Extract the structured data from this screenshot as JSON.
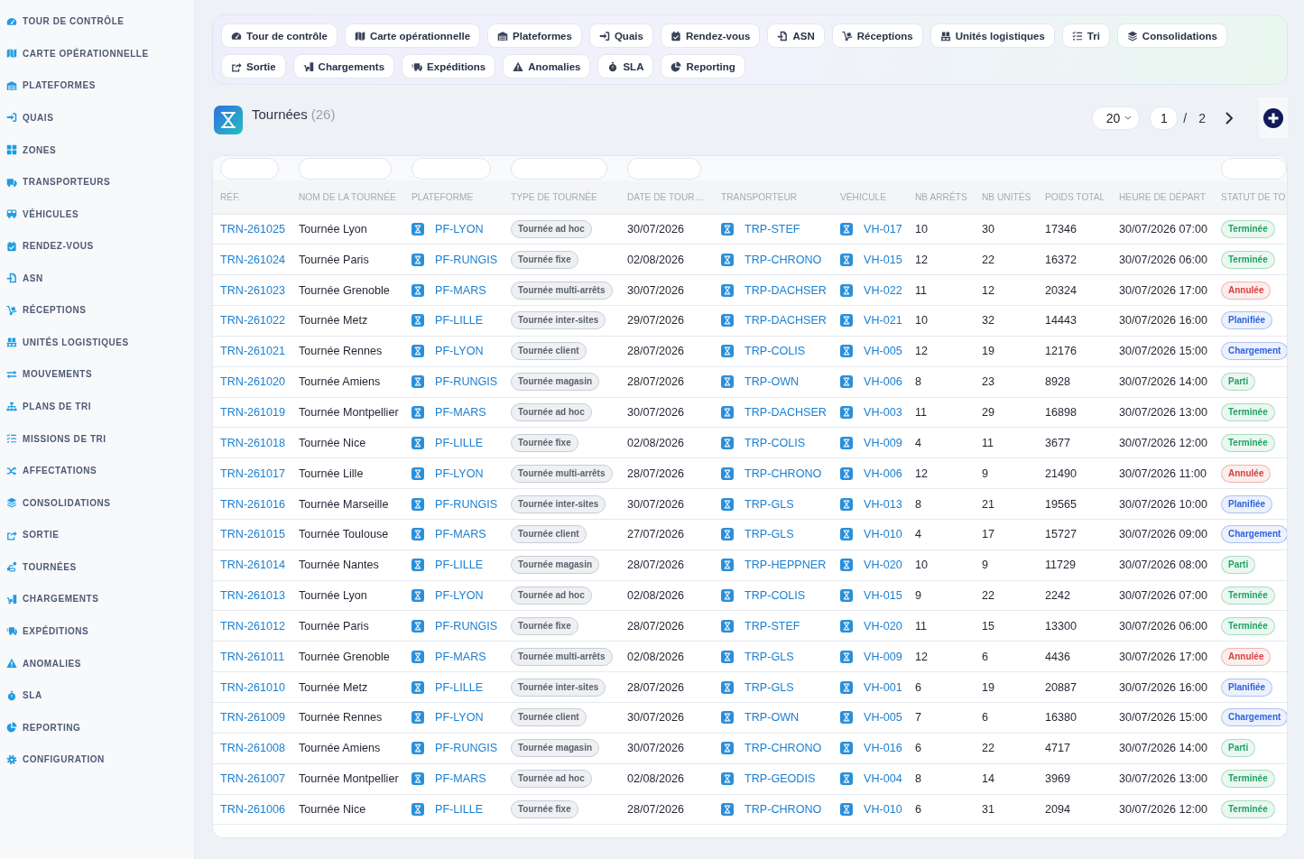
{
  "sidebar": {
    "items": [
      "TOUR DE CONTRÔLE",
      "CARTE OPÉRATIONNELLE",
      "PLATEFORMES",
      "QUAIS",
      "ZONES",
      "TRANSPORTEURS",
      "VÉHICULES",
      "RENDEZ-VOUS",
      "ASN",
      "RÉCEPTIONS",
      "UNITÉS LOGISTIQUES",
      "MOUVEMENTS",
      "PLANS DE TRI",
      "MISSIONS DE TRI",
      "AFFECTATIONS",
      "CONSOLIDATIONS",
      "SORTIE",
      "TOURNÉES",
      "CHARGEMENTS",
      "EXPÉDITIONS",
      "ANOMALIES",
      "SLA",
      "REPORTING",
      "CONFIGURATION"
    ]
  },
  "nav": {
    "tabs": [
      "Tour de contrôle",
      "Carte opérationnelle",
      "Plateformes",
      "Quais",
      "Rendez-vous",
      "ASN",
      "Réceptions",
      "Unités logistiques",
      "Tri",
      "Consolidations",
      "Sortie",
      "Chargements",
      "Expéditions",
      "Anomalies",
      "SLA",
      "Reporting"
    ]
  },
  "header": {
    "title": "Tournées",
    "count": "(26)"
  },
  "pager": {
    "page_size": "20",
    "page": "1",
    "separator": "/",
    "total": "2"
  },
  "table": {
    "columns": [
      {
        "label": "RÉF.",
        "filter": true
      },
      {
        "label": "NOM DE LA TOURNÉE",
        "filter": true
      },
      {
        "label": "PLATEFORME",
        "filter": true
      },
      {
        "label": "TYPE DE TOURNÉE",
        "filter": true
      },
      {
        "label": "DATE DE TOUR…",
        "filter": true
      },
      {
        "label": "TRANSPORTEUR",
        "filter": false
      },
      {
        "label": "VÉHICULE",
        "filter": false
      },
      {
        "label": "NB ARRÊTS",
        "filter": false
      },
      {
        "label": "NB UNITÉS",
        "filter": false
      },
      {
        "label": "POIDS TOTAL",
        "filter": false
      },
      {
        "label": "HEURE DE DÉPART",
        "filter": false
      },
      {
        "label": "STATUT DE TO",
        "filter": true
      }
    ],
    "rows": [
      {
        "ref": "TRN-261025",
        "name": "Tournée Lyon",
        "platform": "PF-LYON",
        "type": "Tournée ad hoc",
        "date": "30/07/2026",
        "carrier": "TRP-STEF",
        "vehicle": "VH-017",
        "stops": "10",
        "units": "30",
        "weight": "17346",
        "departure": "30/07/2026 07:00",
        "status": {
          "label": "Terminée",
          "color": "#1fa463"
        }
      },
      {
        "ref": "TRN-261024",
        "name": "Tournée Paris",
        "platform": "PF-RUNGIS",
        "type": "Tournée fixe",
        "date": "02/08/2026",
        "carrier": "TRP-CHRONO",
        "vehicle": "VH-015",
        "stops": "12",
        "units": "22",
        "weight": "16372",
        "departure": "30/07/2026 06:00",
        "status": {
          "label": "Terminée",
          "color": "#1fa463"
        }
      },
      {
        "ref": "TRN-261023",
        "name": "Tournée Grenoble",
        "platform": "PF-MARS",
        "type": "Tournée multi-arrêts",
        "date": "30/07/2026",
        "carrier": "TRP-DACHSER",
        "vehicle": "VH-022",
        "stops": "11",
        "units": "12",
        "weight": "20324",
        "departure": "30/07/2026 17:00",
        "status": {
          "label": "Annulée",
          "color": "#d8403c"
        }
      },
      {
        "ref": "TRN-261022",
        "name": "Tournée Metz",
        "platform": "PF-LILLE",
        "type": "Tournée inter-sites",
        "date": "29/07/2026",
        "carrier": "TRP-DACHSER",
        "vehicle": "VH-021",
        "stops": "10",
        "units": "32",
        "weight": "14443",
        "departure": "30/07/2026 16:00",
        "status": {
          "label": "Planifiée",
          "color": "#2d63df"
        }
      },
      {
        "ref": "TRN-261021",
        "name": "Tournée Rennes",
        "platform": "PF-LYON",
        "type": "Tournée client",
        "date": "28/07/2026",
        "carrier": "TRP-COLIS",
        "vehicle": "VH-005",
        "stops": "12",
        "units": "19",
        "weight": "12176",
        "departure": "30/07/2026 15:00",
        "status": {
          "label": "Chargement",
          "color": "#2d63df"
        }
      },
      {
        "ref": "TRN-261020",
        "name": "Tournée Amiens",
        "platform": "PF-RUNGIS",
        "type": "Tournée magasin",
        "date": "28/07/2026",
        "carrier": "TRP-OWN",
        "vehicle": "VH-006",
        "stops": "8",
        "units": "23",
        "weight": "8928",
        "departure": "30/07/2026 14:00",
        "status": {
          "label": "Parti",
          "color": "#1fa463"
        }
      },
      {
        "ref": "TRN-261019",
        "name": "Tournée Montpellier",
        "platform": "PF-MARS",
        "type": "Tournée ad hoc",
        "date": "30/07/2026",
        "carrier": "TRP-DACHSER",
        "vehicle": "VH-003",
        "stops": "11",
        "units": "29",
        "weight": "16898",
        "departure": "30/07/2026 13:00",
        "status": {
          "label": "Terminée",
          "color": "#1fa463"
        }
      },
      {
        "ref": "TRN-261018",
        "name": "Tournée Nice",
        "platform": "PF-LILLE",
        "type": "Tournée fixe",
        "date": "02/08/2026",
        "carrier": "TRP-COLIS",
        "vehicle": "VH-009",
        "stops": "4",
        "units": "11",
        "weight": "3677",
        "departure": "30/07/2026 12:00",
        "status": {
          "label": "Terminée",
          "color": "#1fa463"
        }
      },
      {
        "ref": "TRN-261017",
        "name": "Tournée Lille",
        "platform": "PF-LYON",
        "type": "Tournée multi-arrêts",
        "date": "28/07/2026",
        "carrier": "TRP-CHRONO",
        "vehicle": "VH-006",
        "stops": "12",
        "units": "9",
        "weight": "21490",
        "departure": "30/07/2026 11:00",
        "status": {
          "label": "Annulée",
          "color": "#d8403c"
        }
      },
      {
        "ref": "TRN-261016",
        "name": "Tournée Marseille",
        "platform": "PF-RUNGIS",
        "type": "Tournée inter-sites",
        "date": "30/07/2026",
        "carrier": "TRP-GLS",
        "vehicle": "VH-013",
        "stops": "8",
        "units": "21",
        "weight": "19565",
        "departure": "30/07/2026 10:00",
        "status": {
          "label": "Planifiée",
          "color": "#2d63df"
        }
      },
      {
        "ref": "TRN-261015",
        "name": "Tournée Toulouse",
        "platform": "PF-MARS",
        "type": "Tournée client",
        "date": "27/07/2026",
        "carrier": "TRP-GLS",
        "vehicle": "VH-010",
        "stops": "4",
        "units": "17",
        "weight": "15727",
        "departure": "30/07/2026 09:00",
        "status": {
          "label": "Chargement",
          "color": "#2d63df"
        }
      },
      {
        "ref": "TRN-261014",
        "name": "Tournée Nantes",
        "platform": "PF-LILLE",
        "type": "Tournée magasin",
        "date": "28/07/2026",
        "carrier": "TRP-HEPPNER",
        "vehicle": "VH-020",
        "stops": "10",
        "units": "9",
        "weight": "11729",
        "departure": "30/07/2026 08:00",
        "status": {
          "label": "Parti",
          "color": "#1fa463"
        }
      },
      {
        "ref": "TRN-261013",
        "name": "Tournée Lyon",
        "platform": "PF-LYON",
        "type": "Tournée ad hoc",
        "date": "02/08/2026",
        "carrier": "TRP-COLIS",
        "vehicle": "VH-015",
        "stops": "9",
        "units": "22",
        "weight": "2242",
        "departure": "30/07/2026 07:00",
        "status": {
          "label": "Terminée",
          "color": "#1fa463"
        }
      },
      {
        "ref": "TRN-261012",
        "name": "Tournée Paris",
        "platform": "PF-RUNGIS",
        "type": "Tournée fixe",
        "date": "28/07/2026",
        "carrier": "TRP-STEF",
        "vehicle": "VH-020",
        "stops": "11",
        "units": "15",
        "weight": "13300",
        "departure": "30/07/2026 06:00",
        "status": {
          "label": "Terminée",
          "color": "#1fa463"
        }
      },
      {
        "ref": "TRN-261011",
        "name": "Tournée Grenoble",
        "platform": "PF-MARS",
        "type": "Tournée multi-arrêts",
        "date": "02/08/2026",
        "carrier": "TRP-GLS",
        "vehicle": "VH-009",
        "stops": "12",
        "units": "6",
        "weight": "4436",
        "departure": "30/07/2026 17:00",
        "status": {
          "label": "Annulée",
          "color": "#d8403c"
        }
      },
      {
        "ref": "TRN-261010",
        "name": "Tournée Metz",
        "platform": "PF-LILLE",
        "type": "Tournée inter-sites",
        "date": "28/07/2026",
        "carrier": "TRP-GLS",
        "vehicle": "VH-001",
        "stops": "6",
        "units": "19",
        "weight": "20887",
        "departure": "30/07/2026 16:00",
        "status": {
          "label": "Planifiée",
          "color": "#2d63df"
        }
      },
      {
        "ref": "TRN-261009",
        "name": "Tournée Rennes",
        "platform": "PF-LYON",
        "type": "Tournée client",
        "date": "30/07/2026",
        "carrier": "TRP-OWN",
        "vehicle": "VH-005",
        "stops": "7",
        "units": "6",
        "weight": "16380",
        "departure": "30/07/2026 15:00",
        "status": {
          "label": "Chargement",
          "color": "#2d63df"
        }
      },
      {
        "ref": "TRN-261008",
        "name": "Tournée Amiens",
        "platform": "PF-RUNGIS",
        "type": "Tournée magasin",
        "date": "30/07/2026",
        "carrier": "TRP-CHRONO",
        "vehicle": "VH-016",
        "stops": "6",
        "units": "22",
        "weight": "4717",
        "departure": "30/07/2026 14:00",
        "status": {
          "label": "Parti",
          "color": "#1fa463"
        }
      },
      {
        "ref": "TRN-261007",
        "name": "Tournée Montpellier",
        "platform": "PF-MARS",
        "type": "Tournée ad hoc",
        "date": "02/08/2026",
        "carrier": "TRP-GEODIS",
        "vehicle": "VH-004",
        "stops": "8",
        "units": "14",
        "weight": "3969",
        "departure": "30/07/2026 13:00",
        "status": {
          "label": "Terminée",
          "color": "#1fa463"
        }
      },
      {
        "ref": "TRN-261006",
        "name": "Tournée Nice",
        "platform": "PF-LILLE",
        "type": "Tournée fixe",
        "date": "28/07/2026",
        "carrier": "TRP-CHRONO",
        "vehicle": "VH-010",
        "stops": "6",
        "units": "31",
        "weight": "2094",
        "departure": "30/07/2026 12:00",
        "status": {
          "label": "Terminée",
          "color": "#1fa463"
        }
      }
    ]
  }
}
